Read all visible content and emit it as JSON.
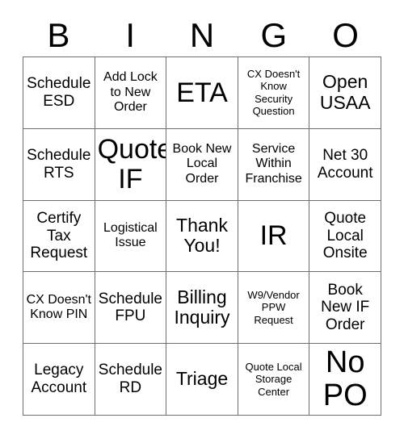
{
  "card": {
    "title": "BINGO",
    "columns": [
      "B",
      "I",
      "N",
      "G",
      "O"
    ],
    "grid_size": "5x5",
    "colors": {
      "background": "#ffffff",
      "text": "#000000",
      "border": "#6e6e6e"
    }
  },
  "header": {
    "letters": [
      {
        "label": "B"
      },
      {
        "label": "I"
      },
      {
        "label": "N"
      },
      {
        "label": "G"
      },
      {
        "label": "O"
      }
    ]
  },
  "cells": [
    {
      "text": "Schedule ESD",
      "size": "sm",
      "row": 1,
      "col": "B"
    },
    {
      "text": "Add Lock to New Order",
      "size": "xs",
      "row": 1,
      "col": "I"
    },
    {
      "text": "ETA",
      "size": "lg",
      "row": 1,
      "col": "N"
    },
    {
      "text": "CX Doesn't Know Security Question",
      "size": "xxs",
      "row": 1,
      "col": "G"
    },
    {
      "text": "Open USAA",
      "size": "md",
      "row": 1,
      "col": "O"
    },
    {
      "text": "Schedule RTS",
      "size": "sm",
      "row": 2,
      "col": "B"
    },
    {
      "text": "Quote IF",
      "size": "lg",
      "row": 2,
      "col": "I"
    },
    {
      "text": "Book New Local Order",
      "size": "xs",
      "row": 2,
      "col": "N"
    },
    {
      "text": "Service Within Franchise",
      "size": "xs",
      "row": 2,
      "col": "G"
    },
    {
      "text": "Net 30 Account",
      "size": "sm",
      "row": 2,
      "col": "O"
    },
    {
      "text": "Certify Tax Request",
      "size": "sm",
      "row": 3,
      "col": "B"
    },
    {
      "text": "Logistical Issue",
      "size": "xs",
      "row": 3,
      "col": "I"
    },
    {
      "text": "Thank You!",
      "size": "md",
      "row": 3,
      "col": "N"
    },
    {
      "text": "IR",
      "size": "lg",
      "row": 3,
      "col": "G"
    },
    {
      "text": "Quote Local Onsite",
      "size": "sm",
      "row": 3,
      "col": "O"
    },
    {
      "text": "CX Doesn't Know PIN",
      "size": "xs",
      "row": 4,
      "col": "B"
    },
    {
      "text": "Schedule FPU",
      "size": "sm",
      "row": 4,
      "col": "I"
    },
    {
      "text": "Billing Inquiry",
      "size": "md",
      "row": 4,
      "col": "N"
    },
    {
      "text": "W9/Vendor PPW Request",
      "size": "xxs",
      "row": 4,
      "col": "G"
    },
    {
      "text": "Book New IF Order",
      "size": "sm",
      "row": 4,
      "col": "O"
    },
    {
      "text": "Legacy Account",
      "size": "sm",
      "row": 5,
      "col": "B"
    },
    {
      "text": "Schedule RD",
      "size": "sm",
      "row": 5,
      "col": "I"
    },
    {
      "text": "Triage",
      "size": "md",
      "row": 5,
      "col": "N"
    },
    {
      "text": "Quote Local Storage Center",
      "size": "xxs",
      "row": 5,
      "col": "G"
    },
    {
      "text": "No PO",
      "size": "xl",
      "row": 5,
      "col": "O"
    }
  ]
}
